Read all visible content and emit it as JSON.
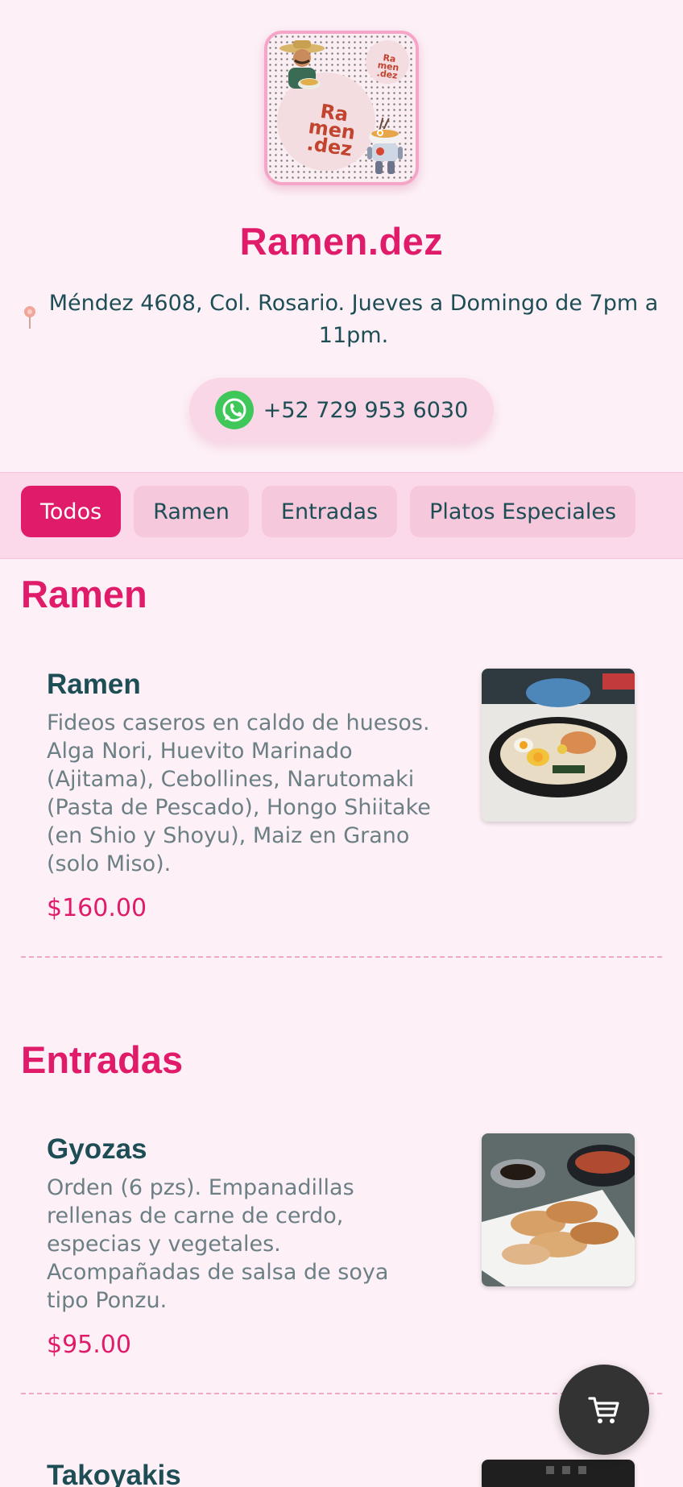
{
  "restaurant": {
    "logo_text": "Ra men .dez",
    "name": "Ramen.dez",
    "address": "Méndez 4608, Col. Rosario. Jueves a Domingo de 7pm a 11pm.",
    "phone": "+52 729 953 6030"
  },
  "tabs": [
    {
      "label": "Todos",
      "active": true
    },
    {
      "label": "Ramen",
      "active": false
    },
    {
      "label": "Entradas",
      "active": false
    },
    {
      "label": "Platos Especiales",
      "active": false
    }
  ],
  "sections": [
    {
      "title": "Ramen",
      "items": [
        {
          "name": "Ramen",
          "description": "Fideos caseros en caldo de huesos. Alga Nori, Huevito Marinado (Ajitama), Cebollines, Narutomaki (Pasta de Pescado), Hongo Shiitake (en Shio y Shoyu), Maiz en Grano (solo Miso).",
          "price": "$160.00",
          "image": "ramen-bowl-photo"
        }
      ]
    },
    {
      "title": "Entradas",
      "items": [
        {
          "name": "Gyozas",
          "description": "Orden (6 pzs). Empanadillas rellenas de carne de cerdo, especias y vegetales. Acompañadas de salsa de soya tipo Ponzu.",
          "price": "$95.00",
          "image": "gyozas-plate-photo"
        },
        {
          "name": "Takoyakis",
          "image": "takoyakis-photo"
        }
      ]
    }
  ],
  "icons": {
    "location": "map-pin-icon",
    "whatsapp": "whatsapp-icon",
    "cart": "shopping-cart-icon"
  },
  "colors": {
    "brand": "#e01b6a",
    "text": "#1d4d55",
    "background": "#fdf1f7",
    "whatsapp": "#3fc75a"
  }
}
